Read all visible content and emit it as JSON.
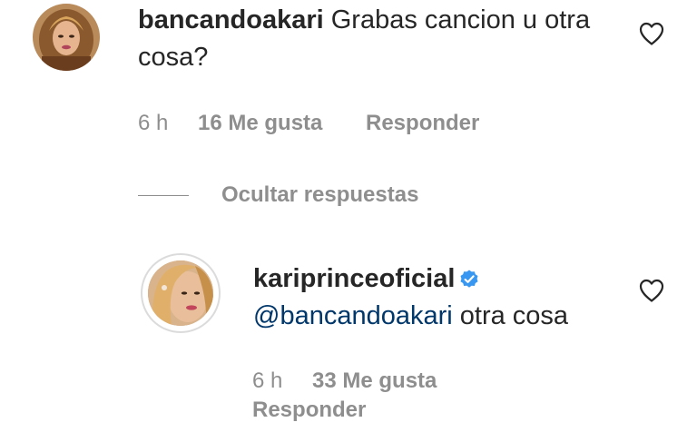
{
  "comments": [
    {
      "username": "bancandoakari",
      "text": "Grabas cancion u otra cosa?",
      "time": "6 h",
      "likes": "16 Me gusta",
      "reply": "Responder"
    }
  ],
  "replies_toggle": {
    "label": "Ocultar respuestas"
  },
  "replies": [
    {
      "username": "kariprinceoficial",
      "verified": true,
      "mention": "@bancandoakari",
      "text": "otra cosa",
      "time": "6 h",
      "likes": "33 Me gusta",
      "reply": "Responder"
    }
  ],
  "icons": {
    "like": "heart-outline-icon",
    "verified": "verified-badge-icon"
  },
  "colors": {
    "text": "#262626",
    "secondary": "#8e8e8e",
    "mention": "#00376b",
    "verified": "#3897f0"
  }
}
